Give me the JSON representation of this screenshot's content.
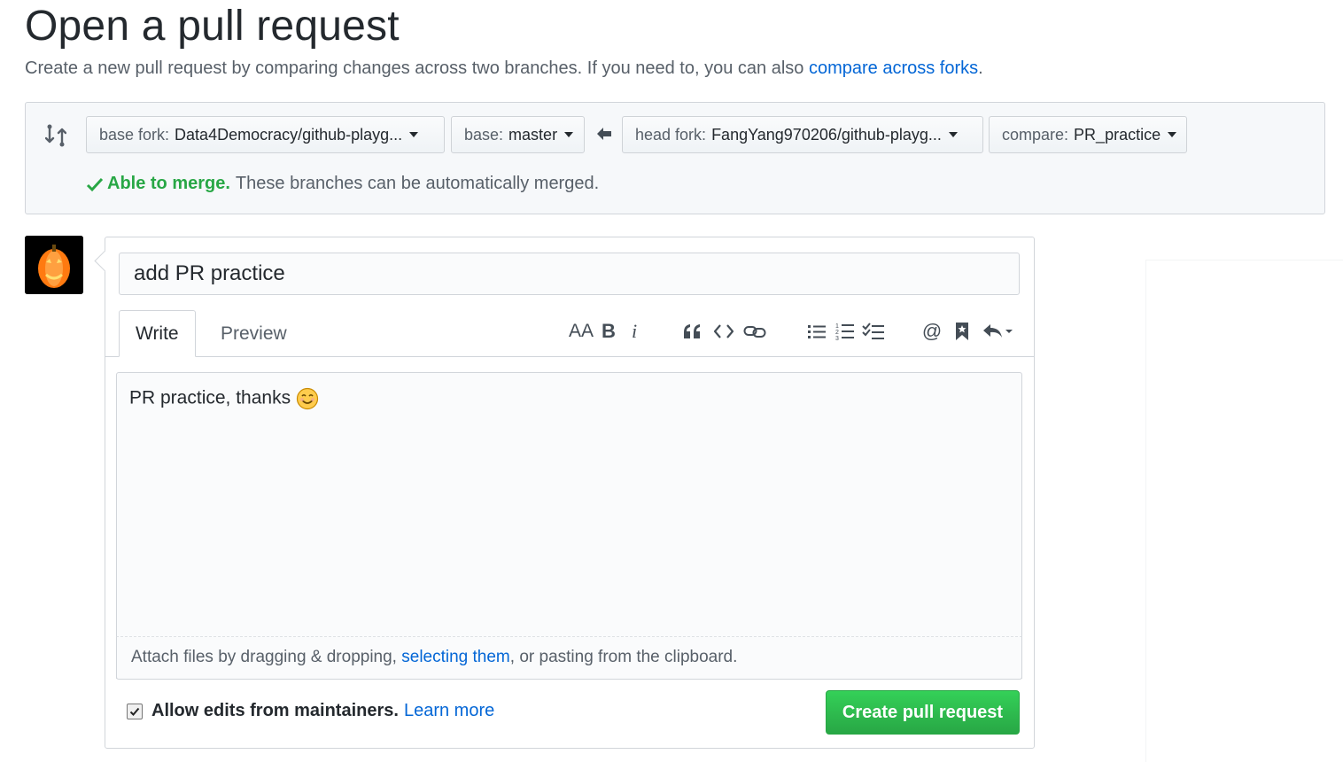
{
  "header": {
    "title": "Open a pull request",
    "description": "Create a new pull request by comparing changes across two branches. If you need to, you can also ",
    "description_link": "compare across forks",
    "description_end": "."
  },
  "range": {
    "base_fork_label": "base fork:",
    "base_fork_value": "Data4Democracy/github-playg...",
    "base_label": "base:",
    "base_value": "master",
    "head_fork_label": "head fork:",
    "head_fork_value": "FangYang970206/github-playg...",
    "compare_label": "compare:",
    "compare_value": "PR_practice",
    "merge_ok": "Able to merge.",
    "merge_text": "These branches can be automatically merged."
  },
  "form": {
    "title_value": "add PR practice",
    "tabs": [
      {
        "label": "Write"
      },
      {
        "label": "Preview"
      }
    ],
    "body_text": "PR practice, thanks",
    "toolbar": {
      "heading": "AA",
      "bold": "B",
      "italic": "i",
      "mention": "@"
    },
    "attach_text": "Attach files by dragging & dropping, ",
    "attach_link": "selecting them",
    "attach_end": ", or pasting from the clipboard.",
    "allow_edits_label": "Allow edits from maintainers.",
    "allow_edits_checked": true,
    "learn_more": "Learn more",
    "submit_label": "Create pull request"
  },
  "colors": {
    "accent": "#0366d6",
    "success": "#28a745"
  }
}
